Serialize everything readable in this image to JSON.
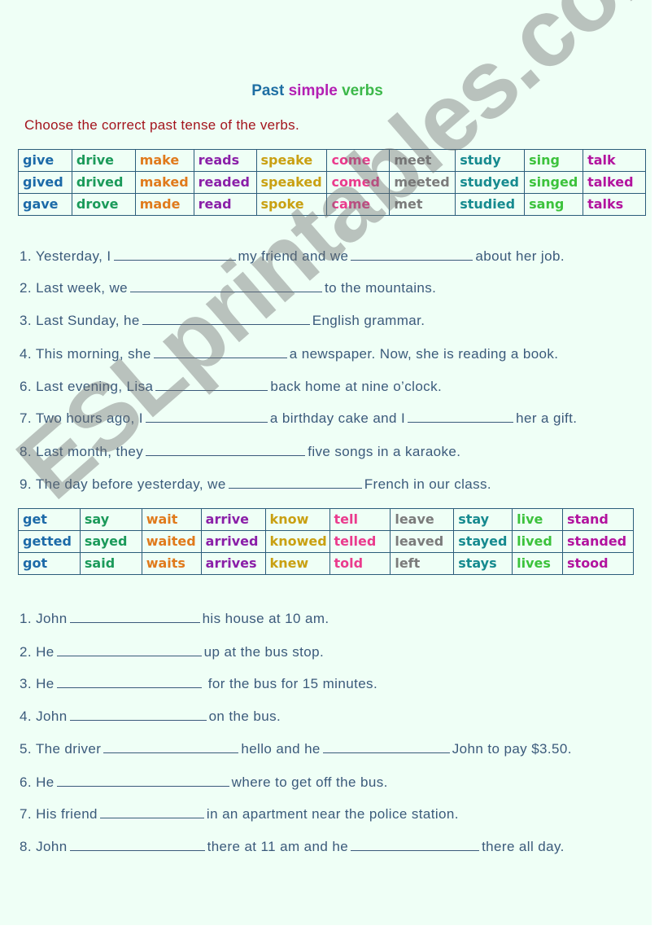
{
  "title": {
    "parts": [
      {
        "text": "Past",
        "color": "#1f6fa3"
      },
      {
        "text": "simple",
        "color": "#b31fb3"
      },
      {
        "text": "verbs",
        "color": "#3cb84a"
      }
    ]
  },
  "instruction": "Choose the correct past tense of the verbs.",
  "colors": {
    "blue": "#1c6aa8",
    "green": "#1b9a5a",
    "orange": "#e07a1c",
    "purple": "#8a1fa8",
    "gold": "#c9a012",
    "pink": "#ea3b8d",
    "gray": "#7b7b7b",
    "teal": "#168a8f",
    "lime": "#3cc23c",
    "magenta": "#b2139e",
    "text": "#3b5a7b",
    "instruction": "#a3131c"
  },
  "table1": {
    "column_colors": [
      "blue",
      "green",
      "orange",
      "purple",
      "gold",
      "pink",
      "gray",
      "teal",
      "lime",
      "magenta"
    ],
    "rows": [
      [
        "give",
        "drive",
        "make",
        "reads",
        "speake",
        "come",
        "meet",
        "study",
        "sing",
        "talk"
      ],
      [
        "gived",
        "drived",
        "maked",
        "readed",
        "speaked",
        "comed",
        "meeted",
        "studyed",
        "singed",
        "talked"
      ],
      [
        "gave",
        "drove",
        "made",
        "read",
        "spoke",
        "came",
        "met",
        "studied",
        "sang",
        "talks"
      ]
    ]
  },
  "section1": [
    {
      "num": "1.",
      "parts": [
        "Yesterday, I",
        "my friend and we",
        "about her job."
      ],
      "blanks": [
        150,
        150
      ]
    },
    {
      "num": "2.",
      "parts": [
        "Last week, we",
        "to the mountains."
      ],
      "blanks": [
        236
      ]
    },
    {
      "num": "3.",
      "parts": [
        "Last Sunday, he",
        "English grammar."
      ],
      "blanks": [
        206
      ]
    },
    {
      "num": "4.",
      "parts": [
        "This morning, she",
        "a newspaper.  Now, she is reading a book."
      ],
      "blanks": [
        164
      ]
    },
    {
      "num": "6.",
      "parts": [
        "Last evening, Lisa",
        "back home at nine o’clock."
      ],
      "blanks": [
        138
      ]
    },
    {
      "num": "7.",
      "parts": [
        "Two hours ago, I",
        "a birthday cake and I",
        "her a gift."
      ],
      "blanks": [
        150,
        130
      ]
    },
    {
      "num": "8.",
      "parts": [
        "Last month, they",
        "five songs in a karaoke."
      ],
      "blanks": [
        196
      ]
    },
    {
      "num": "9.",
      "parts": [
        "The day before yesterday, we",
        "French in our class."
      ],
      "blanks": [
        164
      ]
    }
  ],
  "table2": {
    "column_colors": [
      "blue",
      "green",
      "orange",
      "purple",
      "gold",
      "pink",
      "gray",
      "teal",
      "lime",
      "magenta"
    ],
    "rows": [
      [
        "get",
        "say",
        "wait",
        "arrive",
        "know",
        "tell",
        "leave",
        "stay",
        "live",
        "stand"
      ],
      [
        "getted",
        "sayed",
        "waited",
        "arrived",
        "knowed",
        "telled",
        "leaved",
        "stayed",
        "lived",
        "standed"
      ],
      [
        "got",
        "said",
        "waits",
        "arrives",
        "knew",
        "told",
        "left",
        "stays",
        "lives",
        "stood"
      ]
    ]
  },
  "section2": [
    {
      "num": "1.",
      "parts": [
        "John",
        "his house at 10 am."
      ],
      "blanks": [
        160
      ]
    },
    {
      "num": "2.",
      "parts": [
        "He",
        "up at the bus stop."
      ],
      "blanks": [
        178
      ]
    },
    {
      "num": "3.",
      "parts": [
        "He",
        "  for the bus for 15 minutes."
      ],
      "blanks": [
        178
      ]
    },
    {
      "num": "4.",
      "parts": [
        "John",
        "on the bus."
      ],
      "blanks": [
        168
      ]
    },
    {
      "num": "5.",
      "parts": [
        "The driver",
        "hello and he",
        "John to pay $3.50."
      ],
      "blanks": [
        166,
        156
      ]
    },
    {
      "num": "6.",
      "parts": [
        "He",
        "where to get off the bus."
      ],
      "blanks": [
        212
      ]
    },
    {
      "num": "7.",
      "parts": [
        "His friend",
        "in an apartment near the police station."
      ],
      "blanks": [
        128
      ]
    },
    {
      "num": "8.",
      "parts": [
        "John",
        "there at 11 am and he",
        "there all day."
      ],
      "blanks": [
        166,
        158
      ]
    }
  ],
  "watermark": "ESLprintables.com"
}
